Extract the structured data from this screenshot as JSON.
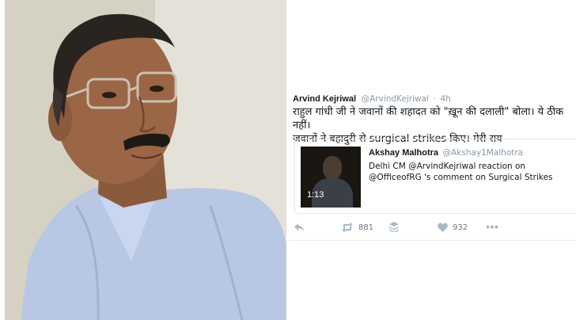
{
  "tweet": {
    "author_name": "Arvind Kejriwal",
    "author_handle": "@ArvindKejriwal",
    "separator": "·",
    "timestamp": "4h",
    "text": "राहुल गांधी जी ने जवानों की शहादत को \"ख़ून की दलाली\" बोला। ये ठीक नहीं।\nजवानों ने बहादुरी से surgical strikes किए। मेरी राय -",
    "quoted": {
      "name": "Akshay Malhotra",
      "handle": "@Akshay1Malhotra",
      "text": "Delhi CM @ArvindKejriwal reaction on @OfficeofRG 's comment on Surgical Strikes",
      "video_duration": "1:13"
    },
    "actions": {
      "retweets": "881",
      "likes": "932"
    }
  },
  "icons": {
    "reply": "reply-icon",
    "retweet": "retweet-icon",
    "stack": "stack-icon",
    "like": "heart-icon",
    "more": "more-icon"
  },
  "colors": {
    "text": "#14171a",
    "muted": "#8899a6",
    "border": "#e1e8ed"
  }
}
